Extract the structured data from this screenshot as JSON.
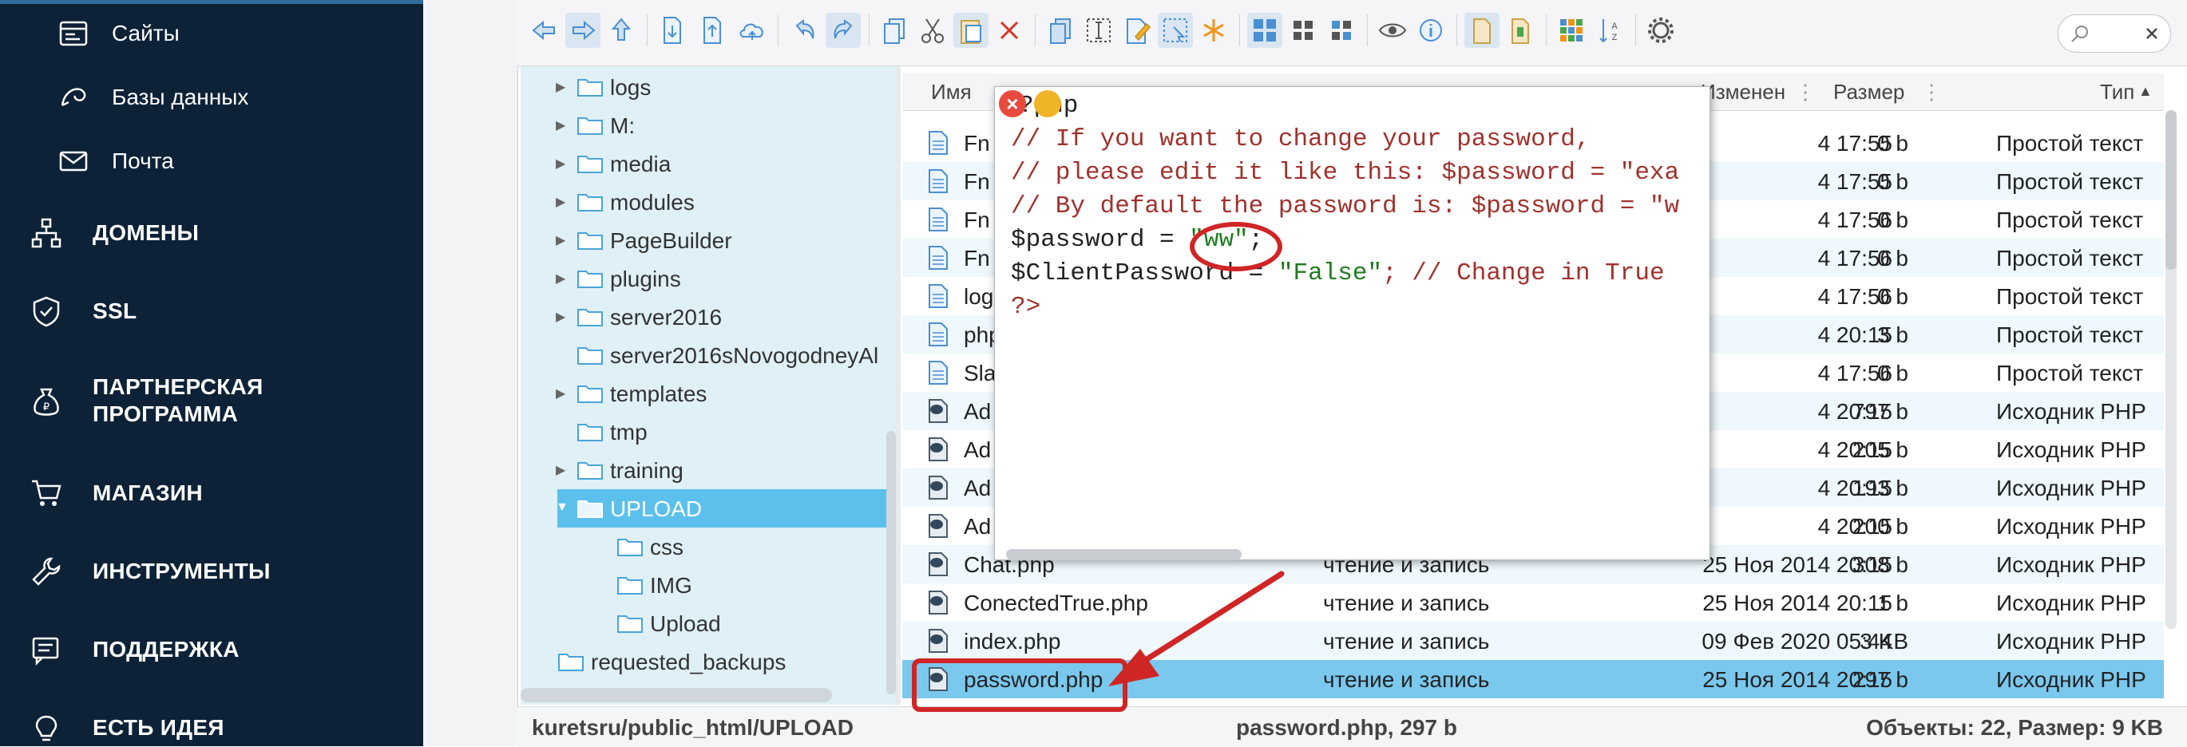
{
  "sidebar": {
    "sub_items": [
      {
        "label": "Сайты",
        "icon": "sites-icon"
      },
      {
        "label": "Базы данных",
        "icon": "database-icon"
      },
      {
        "label": "Почта",
        "icon": "mail-icon"
      }
    ],
    "main_items": [
      {
        "label": "ДОМЕНЫ",
        "icon": "domains-icon"
      },
      {
        "label": "SSL",
        "icon": "shield-icon"
      },
      {
        "label": "ПАРТНЕРСКАЯ",
        "label2": "ПРОГРАММА",
        "icon": "money-bag-icon"
      },
      {
        "label": "МАГАЗИН",
        "icon": "cart-icon"
      },
      {
        "label": "ИНСТРУМЕНТЫ",
        "icon": "wrench-icon"
      },
      {
        "label": "ПОДДЕРЖКА",
        "icon": "support-icon"
      },
      {
        "label": "ЕСТЬ ИДЕЯ",
        "icon": "lightbulb-icon"
      }
    ]
  },
  "tree": {
    "items": [
      {
        "name": "logs",
        "expandable": true
      },
      {
        "name": "M:",
        "expandable": true
      },
      {
        "name": "media",
        "expandable": true
      },
      {
        "name": "modules",
        "expandable": true
      },
      {
        "name": "PageBuilder",
        "expandable": true
      },
      {
        "name": "plugins",
        "expandable": true
      },
      {
        "name": "server2016",
        "expandable": true
      },
      {
        "name": "server2016sNovogodneyAl",
        "expandable": false
      },
      {
        "name": "templates",
        "expandable": true
      },
      {
        "name": "tmp",
        "expandable": false
      },
      {
        "name": "training",
        "expandable": true
      },
      {
        "name": "UPLOAD",
        "expandable": true,
        "selected": true
      },
      {
        "name": "css",
        "expandable": false
      },
      {
        "name": "IMG",
        "expandable": false
      },
      {
        "name": "Upload",
        "expandable": false
      },
      {
        "name": "requested_backups",
        "expandable": false
      }
    ]
  },
  "list": {
    "headers": {
      "name": "Имя",
      "modified": "Изменен",
      "size": "Размер",
      "type": "Тип"
    },
    "rows": [
      {
        "name": "Fn",
        "perm": "",
        "date": "4 17:55",
        "size": "0 b",
        "type": "Простой текст",
        "kind": "text"
      },
      {
        "name": "Fn",
        "perm": "",
        "date": "4 17:55",
        "size": "0 b",
        "type": "Простой текст",
        "kind": "text"
      },
      {
        "name": "Fn",
        "perm": "",
        "date": "4 17:56",
        "size": "0 b",
        "type": "Простой текст",
        "kind": "text"
      },
      {
        "name": "Fn",
        "perm": "",
        "date": "4 17:56",
        "size": "0 b",
        "type": "Простой текст",
        "kind": "text"
      },
      {
        "name": "log",
        "perm": "",
        "date": "4 17:56",
        "size": "0 b",
        "type": "Простой текст",
        "kind": "text"
      },
      {
        "name": "php",
        "perm": "",
        "date": "4 20:15",
        "size": "3 b",
        "type": "Простой текст",
        "kind": "text"
      },
      {
        "name": "Sla",
        "perm": "",
        "date": "4 17:56",
        "size": "0 b",
        "type": "Простой текст",
        "kind": "text"
      },
      {
        "name": "Ad",
        "perm": "",
        "date": "4 20:15",
        "size": "797 b",
        "type": "Исходник PHP",
        "kind": "php"
      },
      {
        "name": "Ad",
        "perm": "",
        "date": "4 20:15",
        "size": "205 b",
        "type": "Исходник PHP",
        "kind": "php"
      },
      {
        "name": "Ad",
        "perm": "",
        "date": "4 20:15",
        "size": "193 b",
        "type": "Исходник PHP",
        "kind": "php"
      },
      {
        "name": "Ad",
        "perm": "",
        "date": "4 20:15",
        "size": "200 b",
        "type": "Исходник PHP",
        "kind": "php"
      },
      {
        "name": "Chat.php",
        "perm": "чтение и запись",
        "date": "25 Ноя 2014 20:15",
        "size": "308 b",
        "type": "Исходник PHP",
        "kind": "php"
      },
      {
        "name": "ConectedTrue.php",
        "perm": "чтение и запись",
        "date": "25 Ноя 2014 20:15",
        "size": "1 b",
        "type": "Исходник PHP",
        "kind": "php"
      },
      {
        "name": "index.php",
        "perm": "чтение и запись",
        "date": "09 Фев 2020 05:44",
        "size": "3 KB",
        "type": "Исходник PHP",
        "kind": "php"
      },
      {
        "name": "password.php",
        "perm": "чтение и запись",
        "date": "25 Ноя 2014 20:15",
        "size": "297 b",
        "type": "Исходник PHP",
        "kind": "php",
        "selected": true
      }
    ]
  },
  "status": {
    "path": "kuretsru/public_html/UPLOAD",
    "file": "password.php, 297 b",
    "summary": "Объекты: 22, Размер: 9 KB"
  },
  "popup": {
    "lines": [
      "?php",
      "// If you want to change your password,",
      "// please edit it like this: $password = \"exa",
      "// By default the password is: $password = \"w",
      "$password = ",
      "\"ww\"",
      ";",
      "$ClientPassword = ",
      "\"False\"",
      "; // Change in True",
      "?>"
    ]
  },
  "colors": {
    "sidebar_bg": "#0d2237",
    "tree_bg": "#dff0f7",
    "selected": "#5bc0eb",
    "annotation": "#d02525",
    "comment": "#a0322d",
    "string": "#1f7a1f"
  }
}
